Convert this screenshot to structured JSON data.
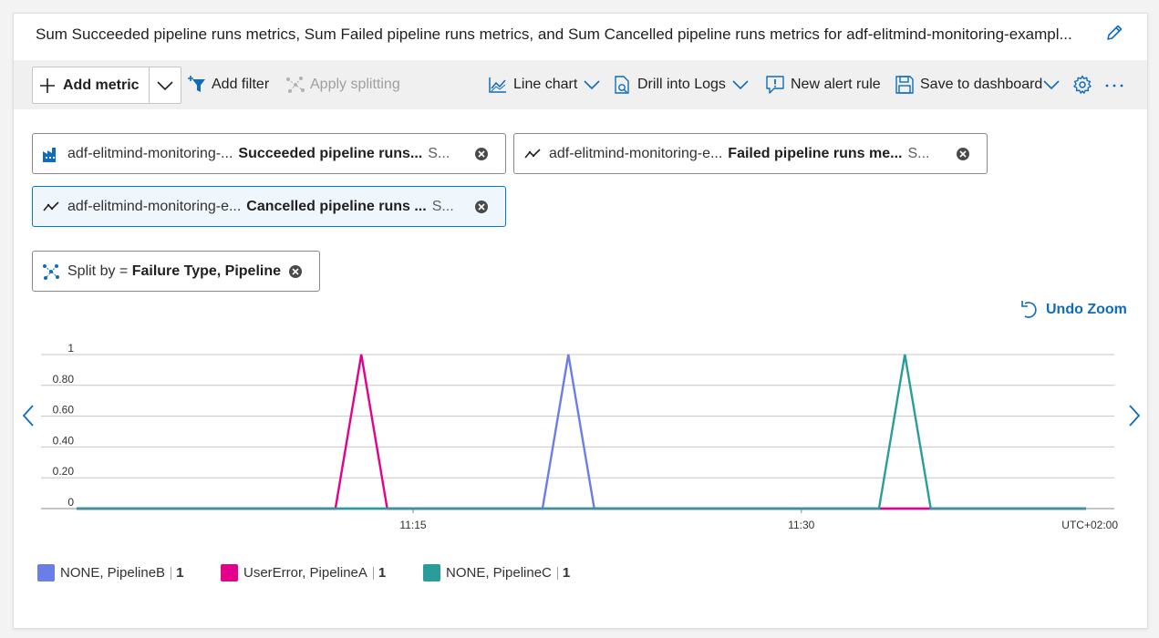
{
  "header": {
    "title": "Sum Succeeded pipeline runs metrics, Sum Failed pipeline runs metrics, and Sum Cancelled pipeline runs metrics for adf-elitmind-monitoring-exampl...",
    "edit_icon": "pencil-icon"
  },
  "toolbar": {
    "add_metric": "Add metric",
    "add_filter": "Add filter",
    "apply_splitting": "Apply splitting",
    "line_chart": "Line chart",
    "drill_logs": "Drill into Logs",
    "new_alert": "New alert rule",
    "save_dashboard": "Save to dashboard",
    "settings_icon": "gear-icon",
    "more_icon": "ellipsis-icon"
  },
  "metric_pills": [
    {
      "resource": "adf-elitmind-monitoring-...",
      "metric": "Succeeded pipeline runs...",
      "agg": "S...",
      "icon": "data-factory-icon"
    },
    {
      "resource": "adf-elitmind-monitoring-e...",
      "metric": "Failed pipeline runs me...",
      "agg": "S...",
      "icon": "metric-line-icon"
    },
    {
      "resource": "adf-elitmind-monitoring-e...",
      "metric": "Cancelled pipeline runs ...",
      "agg": "S...",
      "icon": "metric-line-icon"
    }
  ],
  "split_pill": {
    "prefix": "Split by = ",
    "value": "Failure Type, Pipeline"
  },
  "undo_zoom": "Undo Zoom",
  "chart_data": {
    "type": "line",
    "x_ticks": [
      "11:15",
      "11:30"
    ],
    "timezone_label": "UTC+02:00",
    "y_ticks": [
      "0",
      "0.20",
      "0.40",
      "0.60",
      "0.80",
      "1"
    ],
    "ylim": [
      0,
      1
    ],
    "xlim": [
      "11:02",
      "11:41"
    ],
    "grid": true,
    "legend_position": "bottom-left",
    "series": [
      {
        "name": "NONE, PipelineB",
        "color": "#6b7ee8",
        "legend_value": "1",
        "x": [
          "11:02",
          "11:20",
          "11:21",
          "11:22",
          "11:41"
        ],
        "values": [
          0,
          0,
          1,
          0,
          0
        ]
      },
      {
        "name": "UserError, PipelineA",
        "color": "#e3008c",
        "legend_value": "1",
        "x": [
          "11:02",
          "11:12",
          "11:13",
          "11:14",
          "11:41"
        ],
        "values": [
          0,
          0,
          1,
          0,
          0
        ]
      },
      {
        "name": "NONE, PipelineC",
        "color": "#2a9d9b",
        "legend_value": "1",
        "x": [
          "11:02",
          "11:33",
          "11:34",
          "11:35",
          "11:41"
        ],
        "values": [
          0,
          0,
          1,
          0,
          0
        ]
      }
    ]
  }
}
